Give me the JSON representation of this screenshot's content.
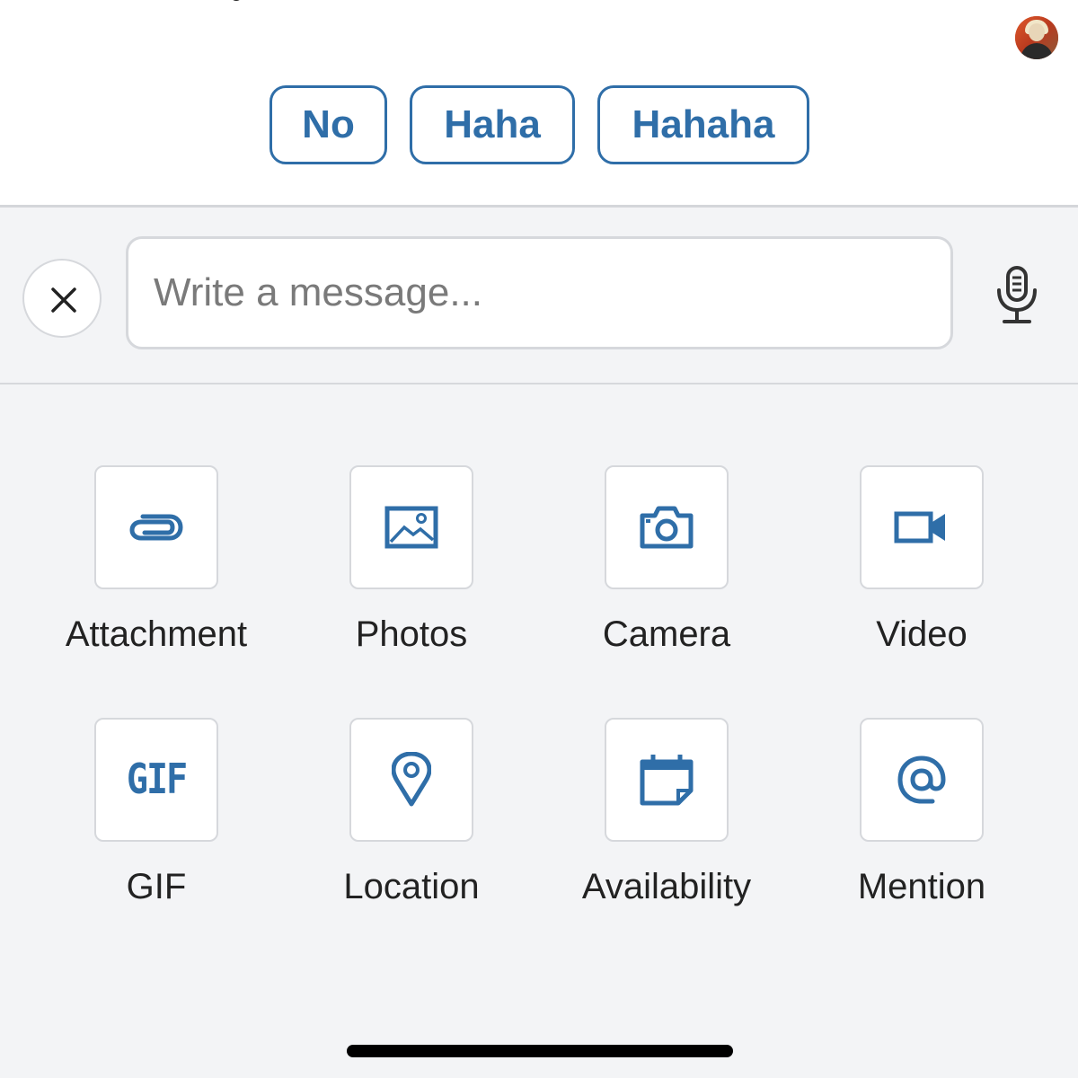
{
  "theme": {
    "accent": "#2f6ea8",
    "background": "#f3f4f6",
    "border": "#d6d8dc"
  },
  "quick_replies": [
    {
      "label": "No"
    },
    {
      "label": "Haha"
    },
    {
      "label": "Hahaha"
    }
  ],
  "composer": {
    "close_icon": "close-icon",
    "placeholder": "Write a message...",
    "mic_icon": "microphone-icon"
  },
  "attachments": [
    {
      "label": "Attachment",
      "icon": "paperclip-icon"
    },
    {
      "label": "Photos",
      "icon": "image-icon"
    },
    {
      "label": "Camera",
      "icon": "camera-icon"
    },
    {
      "label": "Video",
      "icon": "video-camera-icon"
    },
    {
      "label": "GIF",
      "icon": "gif-icon",
      "icon_text": "GIF"
    },
    {
      "label": "Location",
      "icon": "map-pin-icon"
    },
    {
      "label": "Availability",
      "icon": "calendar-icon"
    },
    {
      "label": "Mention",
      "icon": "at-sign-icon"
    }
  ]
}
